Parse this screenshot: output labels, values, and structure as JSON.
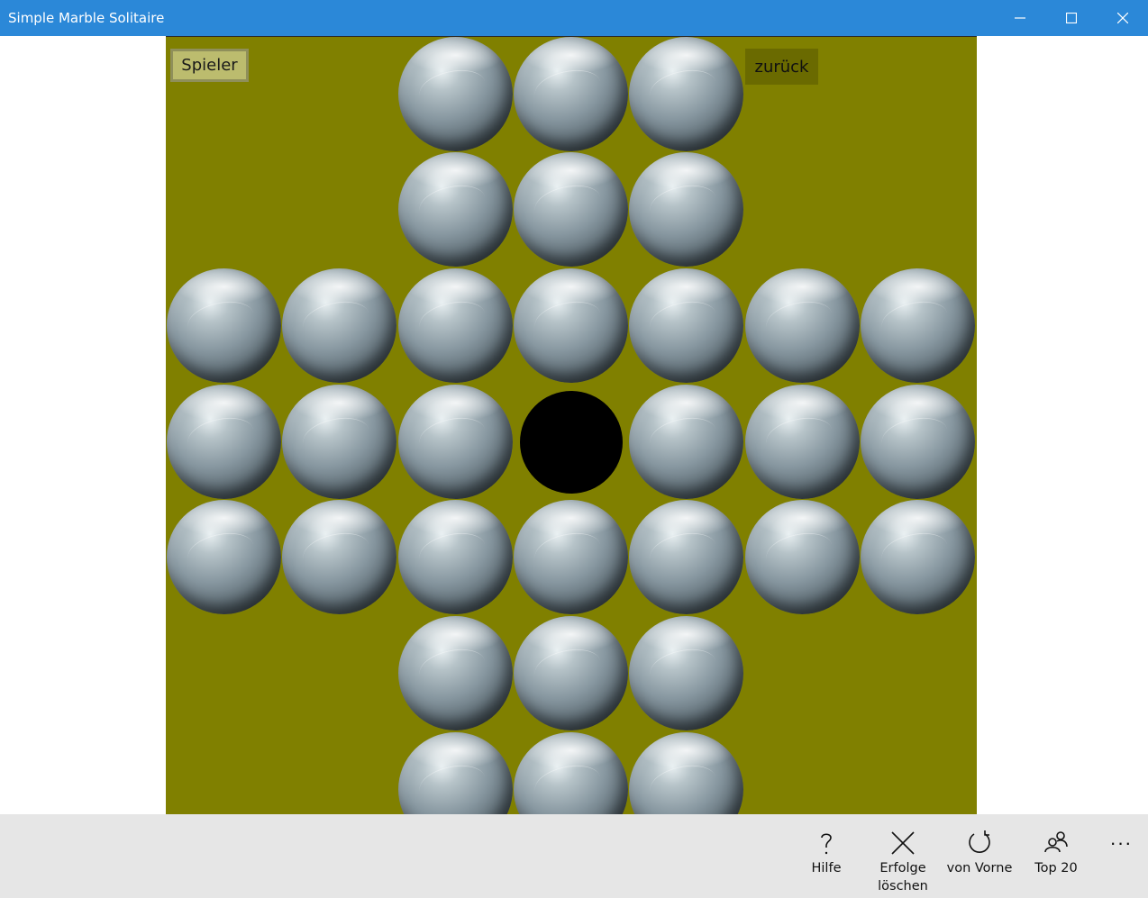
{
  "window": {
    "title": "Simple Marble Solitaire",
    "colors": {
      "titlebar": "#2b88d8",
      "board": "#808000",
      "appbar": "#e6e6e6"
    }
  },
  "game": {
    "player_button": "Spieler",
    "undo_button": "zurück",
    "board": [
      [
        "x",
        "x",
        "o",
        "o",
        "o",
        "x",
        "x"
      ],
      [
        "x",
        "x",
        "o",
        "o",
        "o",
        "x",
        "x"
      ],
      [
        "o",
        "o",
        "o",
        "o",
        "o",
        "o",
        "o"
      ],
      [
        "o",
        "o",
        "o",
        ".",
        "o",
        "o",
        "o"
      ],
      [
        "o",
        "o",
        "o",
        "o",
        "o",
        "o",
        "o"
      ],
      [
        "x",
        "x",
        "o",
        "o",
        "o",
        "x",
        "x"
      ],
      [
        "x",
        "x",
        "o",
        "o",
        "o",
        "x",
        "x"
      ]
    ],
    "legend": {
      "o": "marble",
      ".": "empty-hole",
      "x": "off-board"
    }
  },
  "appbar": {
    "buttons": [
      {
        "id": "help",
        "label": "Hilfe",
        "icon": "question-icon"
      },
      {
        "id": "reset-achievements",
        "label": "Erfolge löschen",
        "icon": "close-icon"
      },
      {
        "id": "restart",
        "label": "von Vorne",
        "icon": "refresh-icon"
      },
      {
        "id": "top20",
        "label": "Top 20",
        "icon": "people-icon"
      }
    ],
    "more": "···"
  }
}
